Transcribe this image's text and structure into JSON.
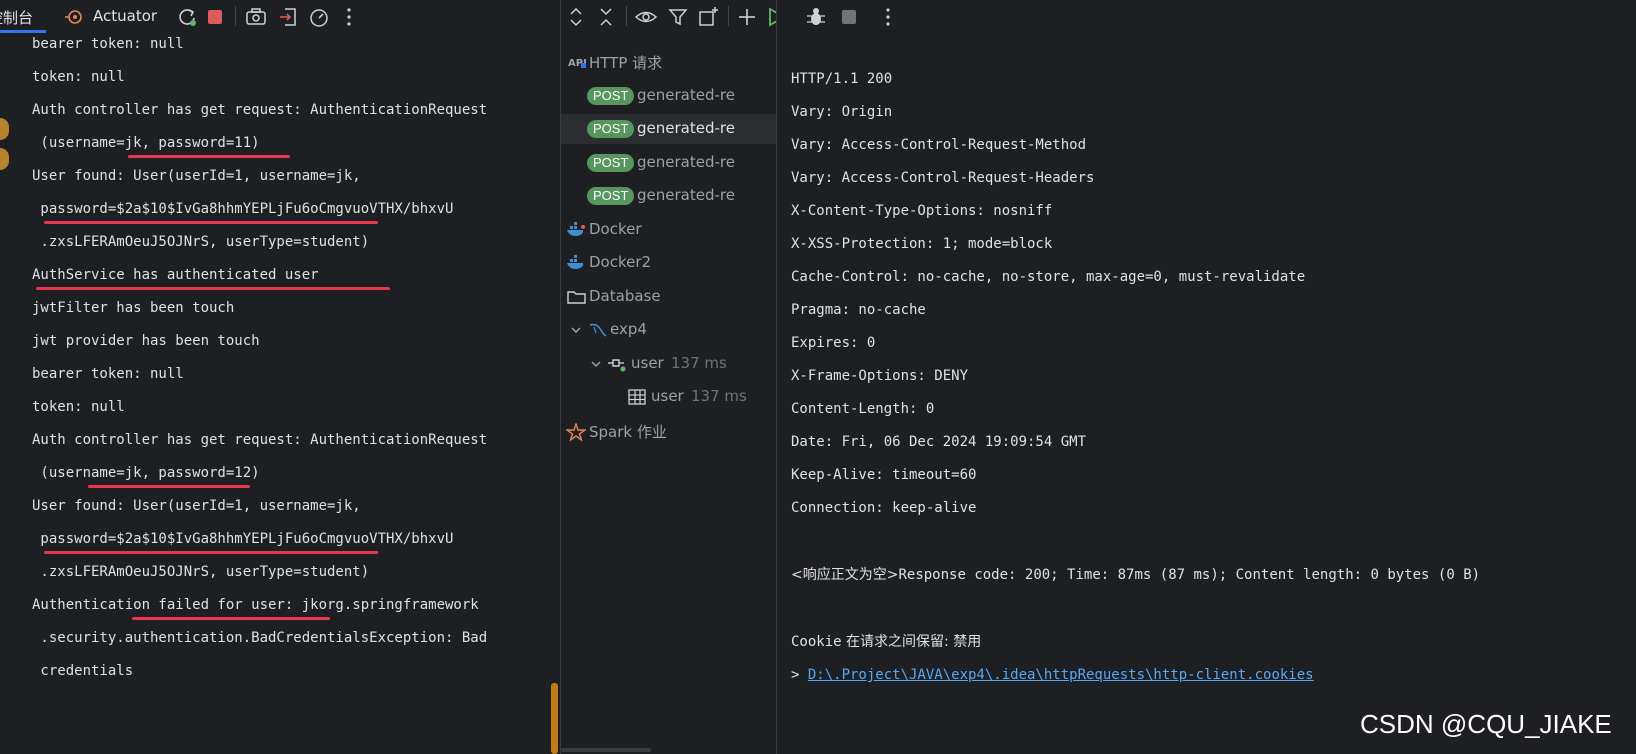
{
  "console": {
    "tabs": {
      "console": "控制台",
      "actuator": "Actuator"
    },
    "lines": [
      "bearer token: null",
      "token: null",
      "Auth controller has get request: AuthenticationRequest",
      " (username=jk, password=11)",
      "User found: User(userId=1, username=jk,",
      " password=$2a$10$IvGa8hhmYEPLjFu6oCmgvuoVTHX/bhxvU",
      " .zxsLFERAmOeuJ5OJNrS, userType=student)",
      "AuthService has authenticated user",
      "jwtFilter has been touch",
      "jwt provider has been touch",
      "bearer token: null",
      "token: null",
      "Auth controller has get request: AuthenticationRequest",
      " (username=jk, password=12)",
      "User found: User(userId=1, username=jk,",
      " password=$2a$10$IvGa8hhmYEPLjFu6oCmgvuoVTHX/bhxvU",
      " .zxsLFERAmOeuJ5OJNrS, userType=student)",
      "Authentication failed for user: jkorg.springframework",
      " .security.authentication.BadCredentialsException: Bad",
      " credentials"
    ]
  },
  "services": {
    "http_group": "HTTP 请求",
    "method": "POST",
    "requests": [
      "generated-re",
      "generated-re",
      "generated-re",
      "generated-re"
    ],
    "docker": "Docker",
    "docker2": "Docker2",
    "database": "Database",
    "db_name": "exp4",
    "session": "user",
    "session_time": "137 ms",
    "table": "user",
    "table_time": "137 ms",
    "spark": "Spark 作业"
  },
  "response": {
    "headers": [
      "HTTP/1.1 200",
      "Vary: Origin",
      "Vary: Access-Control-Request-Method",
      "Vary: Access-Control-Request-Headers",
      "X-Content-Type-Options: nosniff",
      "X-XSS-Protection: 1; mode=block",
      "Cache-Control: no-cache, no-store, max-age=0, must-revalidate",
      "Pragma: no-cache",
      "Expires: 0",
      "X-Frame-Options: DENY",
      "Content-Length: 0",
      "Date: Fri, 06 Dec 2024 19:09:54 GMT",
      "Keep-Alive: timeout=60",
      "Connection: keep-alive"
    ],
    "body_empty": "<响应正文为空>",
    "summary": "Response code: 200; Time: 87ms (87 ms); Content length: 0 bytes (0 B)",
    "cookie_label": "Cookie",
    "cookie_desc": " 在请求之间保留: 禁用",
    "cookie_prefix": "> ",
    "cookie_path": "D:\\.Project\\JAVA\\exp4\\.idea\\httpRequests\\http-client.cookies"
  },
  "watermark": "CSDN @CQU_JIAKE",
  "colors": {
    "background": "#1e1f22",
    "accent": "#3574f0",
    "underline_annotation": "#e8384f",
    "post_badge": "#57965c",
    "link": "#56a8f5",
    "run_green": "#5fb865",
    "stop_red": "#db5c5c"
  }
}
